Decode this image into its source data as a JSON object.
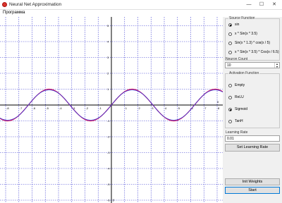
{
  "window": {
    "title": "Neural Net Approximation",
    "minimize": "—",
    "maximize": "☐",
    "close": "✕"
  },
  "menu": {
    "items": [
      "Программа"
    ]
  },
  "plot": {
    "x_axis_label": "x",
    "y_axis_label": "y",
    "x_tick_labels": [
      "-8",
      "-7",
      "-6",
      "-5",
      "-4",
      "-3",
      "-2",
      "-1",
      "1",
      "2",
      "3",
      "4",
      "5",
      "6",
      "7",
      "8"
    ],
    "y_tick_labels": [
      "5",
      "4",
      "3",
      "2",
      "1",
      "-1",
      "-2",
      "-3",
      "-4",
      "-5",
      "-6"
    ],
    "series_colors": {
      "target": "#d01060",
      "approximation": "#3a3ad8"
    },
    "axis_color": "#000000",
    "grid_color": "#3c3cd2"
  },
  "chart_data": {
    "type": "line",
    "xlim": [
      -8,
      8
    ],
    "ylim": [
      -6,
      5.5
    ],
    "grid": true,
    "series": [
      {
        "function": "sin(x)",
        "x": [
          -8,
          -7,
          -6,
          -5,
          -4,
          -3,
          -2,
          -1,
          0,
          1,
          2,
          3,
          4,
          5,
          6,
          7,
          8
        ]
      },
      {
        "function": "approximation",
        "x": [
          -8,
          -7,
          -6,
          -5,
          -4,
          -3,
          -2,
          -1,
          0,
          1,
          2,
          3,
          4,
          5,
          6,
          7,
          8
        ]
      }
    ]
  },
  "source_function": {
    "title": "Source Function",
    "options": [
      "sin",
      "x * Sin(x * 3.5)",
      "Sin(x * 1.3) * cos(x / 5)",
      "x * Sin(x * 3.5) * Cos(x / 6.5)"
    ],
    "selected": 0
  },
  "neuron_count": {
    "label": "Neuron Count",
    "value": "10",
    "up": "▲",
    "down": "▼"
  },
  "activation": {
    "title": "Activation Function",
    "options": [
      "Empty",
      "ReLU",
      "Sigmoid",
      "TanH"
    ],
    "selected": 2
  },
  "learning_rate": {
    "label": "Learning Rate",
    "value": "0.01",
    "button": "Set Learning Rate"
  },
  "buttons": {
    "init_weights": "Init Weights",
    "start": "Start"
  }
}
